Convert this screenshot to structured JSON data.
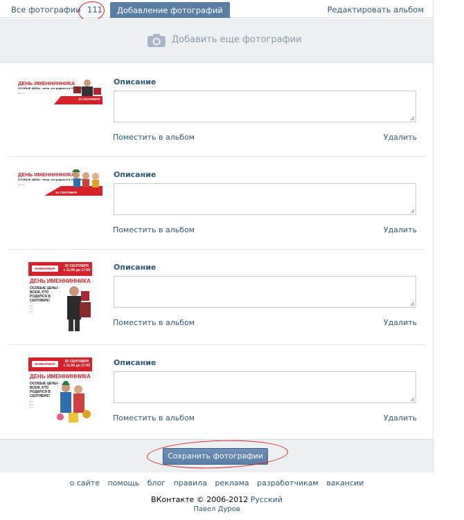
{
  "tabs": {
    "all_photos": "Все фотографии",
    "count": "111",
    "add_photos": "Добавление фотографий",
    "edit_album": "Редактировать альбом"
  },
  "add_more": {
    "label": "Добавить еще фотографии",
    "icon": "camera-icon"
  },
  "photos": [
    {
      "description_label": "Описание",
      "description_value": "",
      "move_label": "Поместить в альбом",
      "delete_label": "Удалить",
      "banner_title": "ДЕНЬ ИМЕННИННИКА",
      "banner_sub": "ОСОБЫЕ ЦЕНЫ - всем, кто родился в СЕНТЯБРЕ!",
      "banner_date": "20 СЕНТЯБРЯ"
    },
    {
      "description_label": "Описание",
      "description_value": "",
      "move_label": "Поместить в альбом",
      "delete_label": "Удалить",
      "banner_title": "ДЕНЬ ИМЕННИННИКА",
      "banner_sub": "ОСОБЫЕ ЦЕНЫ - всем, кто родился в СЕНТЯБРЕ!",
      "banner_date": "20 СЕНТЯБРЯ"
    },
    {
      "description_label": "Описание",
      "description_value": "",
      "move_label": "Поместить в альбом",
      "delete_label": "Удалить",
      "banner_brand": "БАМБАРБИЯ",
      "banner_date": "20 СЕНТЯБРЯ",
      "banner_time": "с 11:00 до 17:00",
      "banner_title": "ДЕНЬ ИМЕННИННИКА",
      "banner_sub": "ОСОБЫЕ ЦЕНЫ - ВСЕМ, КТО РОДИЛСЯ В СЕНТЯБРЕ!"
    },
    {
      "description_label": "Описание",
      "description_value": "",
      "move_label": "Поместить в альбом",
      "delete_label": "Удалить",
      "banner_brand": "БАМБАРБИЯ",
      "banner_date": "20 СЕНТЯБРЯ",
      "banner_time": "с 11:00 до 17:00",
      "banner_title": "ДЕНЬ ИМЕННИННИКА",
      "banner_sub": "ОСОБЫЕ ЦЕНЫ - ВСЕМ, КТО РОДИЛСЯ В СЕНТЯБРЕ!"
    }
  ],
  "save": {
    "label": "Сохранить фотографии"
  },
  "footer": {
    "links": [
      "о сайте",
      "помощь",
      "блог",
      "правила",
      "реклама",
      "разработчикам",
      "вакансии"
    ],
    "copyright": "ВКонтакте © 2006-2012",
    "language": "Русский",
    "author": "Павел Дуров"
  },
  "colors": {
    "link": "#2b587a",
    "active_tab": "#597da3",
    "panel_bg": "#edf0f3",
    "annotation_red": "#e31a1c",
    "banner_red": "#d8202a"
  }
}
